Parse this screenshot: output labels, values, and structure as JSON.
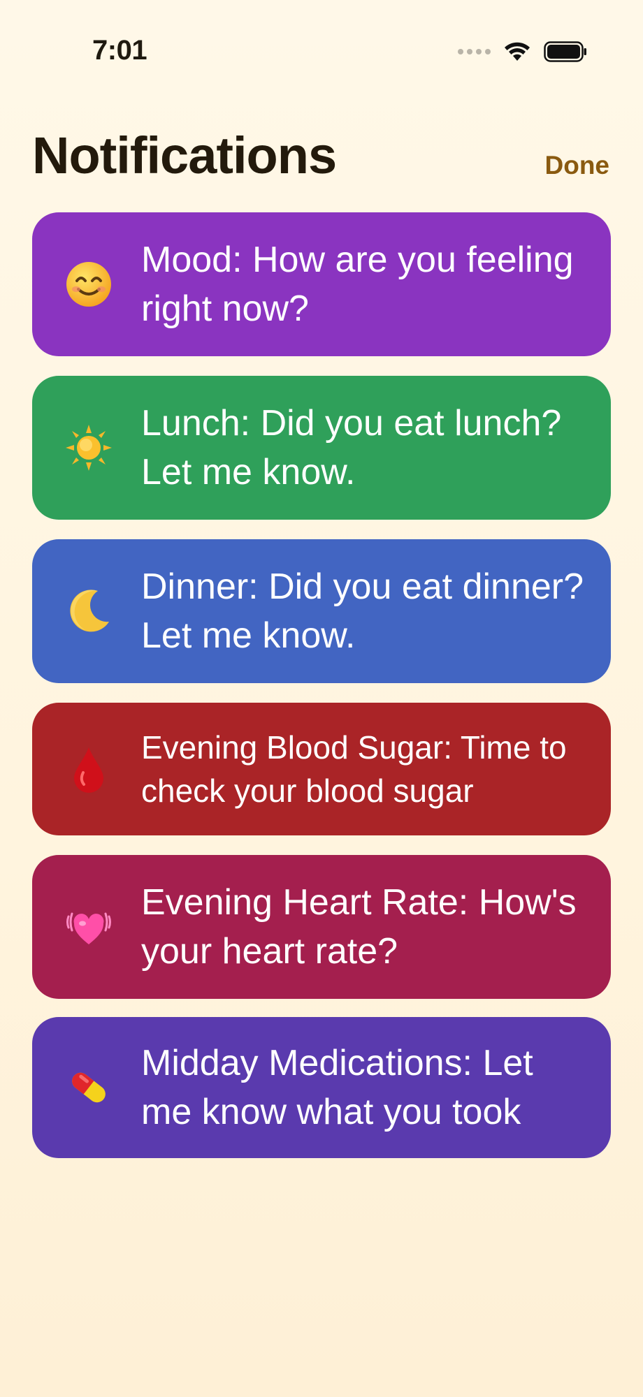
{
  "status_bar": {
    "time": "7:01",
    "icons": [
      "signal-dots-icon",
      "wifi-icon",
      "battery-icon"
    ]
  },
  "header": {
    "title": "Notifications",
    "done_label": "Done"
  },
  "colors": {
    "background": "#fff6e2",
    "title": "#231a0c",
    "done": "#8a5a10"
  },
  "notifications": [
    {
      "icon": "smiling-face-icon",
      "text": "Mood: How are you feeling right now?",
      "color": "#8a34c0"
    },
    {
      "icon": "sun-icon",
      "text": "Lunch: Did you eat lunch? Let me know.",
      "color": "#2fa05a"
    },
    {
      "icon": "crescent-moon-icon",
      "text": "Dinner: Did you eat dinner? Let me know.",
      "color": "#4265c2"
    },
    {
      "icon": "blood-drop-icon",
      "text": "Evening Blood Sugar: Time to check your blood sugar",
      "color": "#aa2427"
    },
    {
      "icon": "beating-heart-icon",
      "text": "Evening Heart Rate: How's your heart rate?",
      "color": "#a41f4e"
    },
    {
      "icon": "pill-icon",
      "text": "Midday Medications: Let me know what you took",
      "color": "#5a3aae"
    }
  ]
}
